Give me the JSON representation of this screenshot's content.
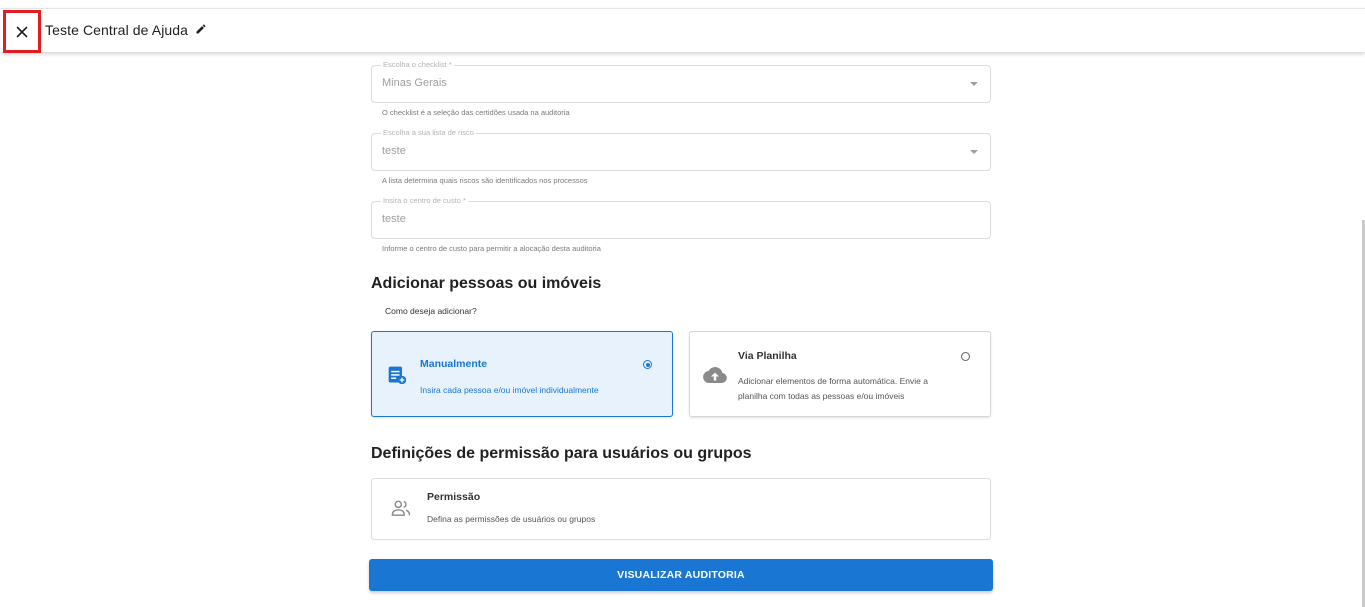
{
  "header": {
    "title": "Teste Central de Ajuda"
  },
  "form": {
    "checklist": {
      "label": "Escolha o checklist *",
      "value": "Minas Gerais",
      "helper": "O checklist é a seleção das certidões usada na auditoria"
    },
    "risk_list": {
      "label": "Escolha a sua lista de risco",
      "value": "teste",
      "helper": "A lista determina quais riscos são identificados nos processos"
    },
    "cost_center": {
      "label": "Insira o centro de custo *",
      "value": "teste",
      "helper": "Informe o centro de custo para permitir a alocação desta auditoria"
    }
  },
  "add_section": {
    "title": "Adicionar pessoas ou imóveis",
    "question": "Como deseja adicionar?",
    "options": [
      {
        "title": "Manualmente",
        "description": "Insira cada pessoa e/ou imóvel individualmente",
        "icon": "playlist-add-icon",
        "selected": true
      },
      {
        "title": "Via Planilha",
        "description_line1": "Adicionar elementos de forma automática. Envie a",
        "description_line2": "planilha com todas as pessoas e/ou imóveis",
        "icon": "cloud-upload-icon",
        "selected": false
      }
    ]
  },
  "permissions_section": {
    "title": "Definições de permissão para usuários ou grupos",
    "card_title": "Permissão",
    "card_description": "Defina as permissões de usuários ou grupos",
    "icon": "people-icon"
  },
  "actions": {
    "view_audit": "VISUALIZAR AUDITORIA"
  },
  "colors": {
    "accent": "#1976d2",
    "selected_bg": "#e8f2fc",
    "highlight_box": "#e11d23"
  }
}
